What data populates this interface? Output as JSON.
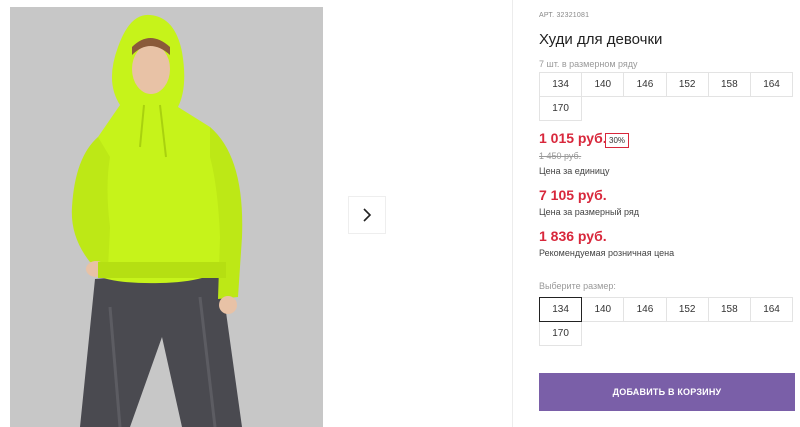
{
  "product": {
    "sku_label": "АРТ.",
    "sku_value": "32321081",
    "title": "Худи для девочки",
    "row_note": "7 шт. в размерном ряду",
    "row_sizes": [
      "134",
      "140",
      "146",
      "152",
      "158",
      "164",
      "170"
    ],
    "price": {
      "current": "1 015 руб.",
      "discount": "30%",
      "old": "1 450 руб.",
      "unit_label": "Цена за единицу",
      "row_price": "7 105 руб.",
      "row_label": "Цена за размерный ряд",
      "rrp": "1 836 руб.",
      "rrp_label": "Рекомендуемая розничная цена"
    },
    "size_picker": {
      "label": "Выберите размер:",
      "sizes": [
        "134",
        "140",
        "146",
        "152",
        "158",
        "164",
        "170"
      ],
      "selected": "134"
    },
    "add_to_cart": "Добавить в корзину"
  },
  "colors": {
    "price_red": "#d8273b",
    "button_purple": "#7a5fa8",
    "hoodie_green": "#c6f31a",
    "jeans_grey": "#4a4a50"
  },
  "icons": {
    "next": "chevron-right-icon"
  }
}
